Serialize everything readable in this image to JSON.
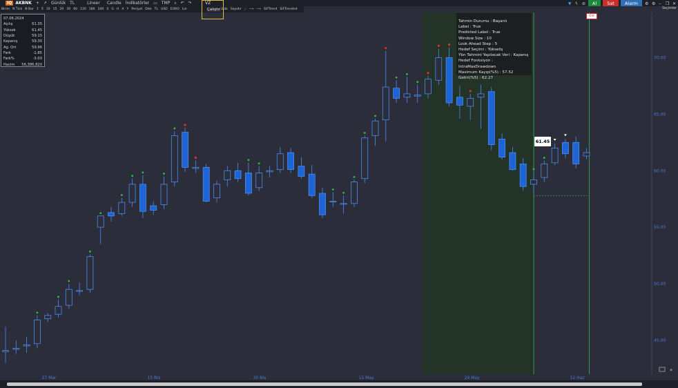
{
  "toolbar": {
    "symbol": "AKBNK",
    "plus": "+",
    "period": "Günlük",
    "currency": "TL",
    "scale": "Lineer",
    "chart_style": "Candle",
    "indicators": "İndikatörler",
    "tmp": "TMP",
    "vz": "VZ",
    "run": "Çalıştır",
    "sub_items": [
      "Birim",
      "N Tick",
      "N Bar",
      "1",
      "5",
      "10",
      "15",
      "20",
      "30",
      "60",
      "120",
      "180",
      "240",
      "S",
      "G",
      "H",
      "A",
      "Y",
      "Periyot",
      "Dde",
      "TL",
      "USD",
      "EURO",
      "Lin"
    ],
    "draw_items": [
      "Uzak",
      "Sayıdır"
    ],
    "trend_items": [
      "SiFTrend",
      "SiFTrendnd"
    ],
    "buy": "Al",
    "sell": "Sat",
    "alarm": "Alarm",
    "secimler": "Seçimler"
  },
  "info": {
    "date": "07.06.2024",
    "rows": [
      {
        "label": "Açılış",
        "value": "61.35"
      },
      {
        "label": "Yüksek",
        "value": "61.45"
      },
      {
        "label": "Düşük",
        "value": "59.15"
      },
      {
        "label": "Kapanış",
        "value": "59.30"
      },
      {
        "label": "Ag. Ort",
        "value": "59.96"
      },
      {
        "label": "Fark",
        "value": "-1.85"
      },
      {
        "label": "Fark%",
        "value": "-3.03"
      },
      {
        "label": "Hacim",
        "value": "56,386,820"
      }
    ]
  },
  "tooltip": {
    "lines": [
      "Tahmin Durumu : Başarılı",
      "Label : True",
      "Predicted Label : True",
      "Window Size : 10",
      "Look Ahead Step : 5",
      "Hedef Seçimi : Yükseliş",
      "Ybn Tahmini Yapılacak Veri : Kapanış",
      "Hedef Fonksiyon : IntraMaxDrawdown",
      "Maximum Kayıp(%5) : 57.52",
      "Getiri(%5) : 62.27"
    ]
  },
  "last_price": "61.45",
  "ust_label": "Üst",
  "colors": {
    "background": "#2b2d3a",
    "candle_body": "#1f64d4",
    "candle_border": "#4b8df0",
    "hollow_fill": "#2b2d3a",
    "up_marker": "#2fbf3f",
    "down_marker": "#e03030",
    "highlight_zone": "#233327",
    "vline": "#39b54a"
  },
  "chart_data": {
    "type": "candlestick",
    "y_ticks": [
      "70.00",
      "65.00",
      "60.00",
      "55.00",
      "50.00",
      "45.00"
    ],
    "ylim": [
      42.0,
      74.0
    ],
    "x_ticks": [
      "27 Mar",
      "15 Nis",
      "30 Nis",
      "15 May",
      "29 May",
      "12 Haz"
    ],
    "candles": [
      {
        "o": 44.0,
        "h": 46.2,
        "l": 43.0,
        "c": 44.1,
        "filled": false
      },
      {
        "o": 44.2,
        "h": 45.0,
        "l": 43.8,
        "c": 44.3,
        "filled": false
      },
      {
        "o": 44.5,
        "h": 45.3,
        "l": 43.9,
        "c": 44.6,
        "filled": false
      },
      {
        "o": 44.7,
        "h": 47.2,
        "l": 44.3,
        "c": 46.8,
        "filled": false,
        "marker": "up"
      },
      {
        "o": 46.9,
        "h": 47.4,
        "l": 46.6,
        "c": 47.2,
        "filled": false
      },
      {
        "o": 47.3,
        "h": 48.6,
        "l": 47.0,
        "c": 48.0,
        "filled": false,
        "marker": "up"
      },
      {
        "o": 48.1,
        "h": 50.0,
        "l": 47.8,
        "c": 49.5,
        "filled": false,
        "marker": "up"
      },
      {
        "o": 49.4,
        "h": 50.1,
        "l": 49.0,
        "c": 49.4,
        "filled": false
      },
      {
        "o": 49.5,
        "h": 52.6,
        "l": 49.2,
        "c": 52.4,
        "filled": false,
        "marker": "up"
      },
      {
        "o": 55.0,
        "h": 56.0,
        "l": 53.5,
        "c": 56.0,
        "filled": false,
        "marker": "up"
      },
      {
        "o": 56.0,
        "h": 56.8,
        "l": 55.5,
        "c": 56.3,
        "filled": true
      },
      {
        "o": 56.2,
        "h": 57.6,
        "l": 56.0,
        "c": 57.2,
        "filled": false,
        "marker": "up"
      },
      {
        "o": 57.2,
        "h": 59.3,
        "l": 56.8,
        "c": 58.8,
        "filled": false,
        "marker": "up"
      },
      {
        "o": 58.8,
        "h": 59.6,
        "l": 55.8,
        "c": 56.4,
        "filled": true,
        "marker": "up"
      },
      {
        "o": 56.5,
        "h": 57.3,
        "l": 56.1,
        "c": 56.9,
        "filled": true
      },
      {
        "o": 57.0,
        "h": 59.5,
        "l": 56.6,
        "c": 58.8,
        "filled": false,
        "marker": "up"
      },
      {
        "o": 59.0,
        "h": 63.5,
        "l": 58.6,
        "c": 63.1,
        "filled": false,
        "marker": "up"
      },
      {
        "o": 63.4,
        "h": 63.8,
        "l": 59.9,
        "c": 60.3,
        "filled": true,
        "marker": "down"
      },
      {
        "o": 60.3,
        "h": 60.9,
        "l": 59.8,
        "c": 60.2,
        "filled": false,
        "marker": "down"
      },
      {
        "o": 60.3,
        "h": 60.6,
        "l": 57.2,
        "c": 57.3,
        "filled": true
      },
      {
        "o": 57.6,
        "h": 59.1,
        "l": 57.2,
        "c": 58.8,
        "filled": false
      },
      {
        "o": 59.2,
        "h": 60.4,
        "l": 58.6,
        "c": 60.0,
        "filled": false
      },
      {
        "o": 60.0,
        "h": 60.7,
        "l": 59.0,
        "c": 59.3,
        "filled": true
      },
      {
        "o": 59.8,
        "h": 60.7,
        "l": 57.8,
        "c": 58.0,
        "filled": true,
        "marker": "up"
      },
      {
        "o": 58.5,
        "h": 60.4,
        "l": 58.2,
        "c": 59.8,
        "filled": false,
        "marker": "up"
      },
      {
        "o": 59.9,
        "h": 60.4,
        "l": 59.4,
        "c": 60.0,
        "filled": false
      },
      {
        "o": 60.1,
        "h": 62.1,
        "l": 59.8,
        "c": 61.5,
        "filled": false
      },
      {
        "o": 61.6,
        "h": 62.0,
        "l": 59.8,
        "c": 60.1,
        "filled": true
      },
      {
        "o": 60.4,
        "h": 61.2,
        "l": 59.3,
        "c": 59.5,
        "filled": true
      },
      {
        "o": 59.7,
        "h": 60.5,
        "l": 57.6,
        "c": 57.8,
        "filled": true
      },
      {
        "o": 58.0,
        "h": 58.5,
        "l": 55.8,
        "c": 56.1,
        "filled": true
      },
      {
        "o": 57.3,
        "h": 58.1,
        "l": 56.8,
        "c": 57.3,
        "filled": false,
        "marker": "up"
      },
      {
        "o": 57.1,
        "h": 57.8,
        "l": 56.2,
        "c": 57.1,
        "filled": false,
        "marker": "up"
      },
      {
        "o": 57.1,
        "h": 59.2,
        "l": 56.8,
        "c": 59.0,
        "filled": false,
        "marker": "up"
      },
      {
        "o": 59.3,
        "h": 63.1,
        "l": 58.9,
        "c": 62.9,
        "filled": false,
        "marker": "up"
      },
      {
        "o": 63.1,
        "h": 64.6,
        "l": 62.2,
        "c": 64.4,
        "filled": false,
        "marker": "up"
      },
      {
        "o": 64.5,
        "h": 70.6,
        "l": 62.6,
        "c": 67.4,
        "filled": false,
        "marker": "down"
      },
      {
        "o": 67.3,
        "h": 68.0,
        "l": 66.0,
        "c": 66.4,
        "filled": true,
        "marker": "up"
      },
      {
        "o": 66.5,
        "h": 68.3,
        "l": 66.0,
        "c": 66.8,
        "filled": false,
        "marker": "up"
      },
      {
        "o": 66.6,
        "h": 67.6,
        "l": 66.0,
        "c": 66.7,
        "filled": false,
        "marker": "up"
      },
      {
        "o": 66.8,
        "h": 68.4,
        "l": 66.4,
        "c": 68.1,
        "filled": false,
        "marker": "down"
      },
      {
        "o": 68.0,
        "h": 70.8,
        "l": 67.6,
        "c": 70.0,
        "filled": false,
        "marker": "down"
      },
      {
        "o": 70.0,
        "h": 70.9,
        "l": 65.7,
        "c": 66.0,
        "filled": true,
        "marker": "down"
      },
      {
        "o": 66.5,
        "h": 67.5,
        "l": 64.6,
        "c": 65.8,
        "filled": true
      },
      {
        "o": 65.7,
        "h": 66.8,
        "l": 64.5,
        "c": 66.4,
        "filled": false,
        "marker": "down"
      },
      {
        "o": 66.5,
        "h": 67.6,
        "l": 63.7,
        "c": 66.8,
        "filled": false
      },
      {
        "o": 67.0,
        "h": 67.4,
        "l": 61.8,
        "c": 62.3,
        "filled": true
      },
      {
        "o": 62.8,
        "h": 63.3,
        "l": 61.0,
        "c": 61.2,
        "filled": true
      },
      {
        "o": 61.6,
        "h": 62.1,
        "l": 60.0,
        "c": 60.1,
        "filled": true
      },
      {
        "o": 60.6,
        "h": 61.1,
        "l": 58.2,
        "c": 58.6,
        "filled": true
      },
      {
        "o": 58.8,
        "h": 59.9,
        "l": 58.0,
        "c": 59.2,
        "filled": false,
        "marker": "up"
      },
      {
        "o": 59.4,
        "h": 60.9,
        "l": 59.0,
        "c": 60.6,
        "filled": false,
        "marker": "up"
      },
      {
        "o": 60.7,
        "h": 62.4,
        "l": 60.5,
        "c": 62.0,
        "filled": false,
        "marker": "white_down"
      },
      {
        "o": 61.5,
        "h": 62.8,
        "l": 61.1,
        "c": 62.5,
        "filled": true,
        "marker": "white_down"
      },
      {
        "o": 62.5,
        "h": 63.0,
        "l": 60.2,
        "c": 60.6,
        "filled": true
      },
      {
        "o": 61.3,
        "h": 62.0,
        "l": 61.0,
        "c": 61.6,
        "filled": false
      }
    ]
  }
}
